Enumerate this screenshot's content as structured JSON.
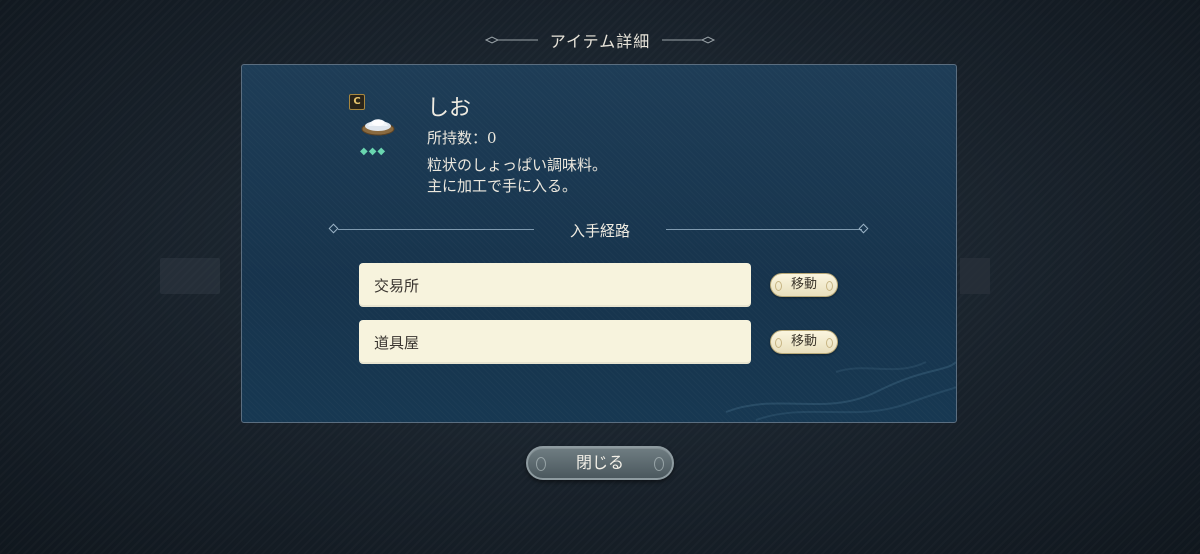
{
  "dialog": {
    "title": "アイテム詳細"
  },
  "item": {
    "rank": "C",
    "name": "しお",
    "owned_label": "所持数：0",
    "rarity": "◆◆◆",
    "description": [
      "粒状のしょっぱい調味料。",
      "主に加工で手に入る。"
    ],
    "icon": "salt-bowl-icon"
  },
  "acquisition": {
    "heading": "入手経路",
    "routes": [
      {
        "label": "交易所",
        "button": "移動"
      },
      {
        "label": "道具屋",
        "button": "移動"
      }
    ]
  },
  "footer": {
    "close_label": "閉じる"
  },
  "colors": {
    "panel": "#1e3d57",
    "route_field": "#f7f3dd",
    "rarity": "#6ad6b0",
    "rank_badge": "#e8c56d"
  }
}
